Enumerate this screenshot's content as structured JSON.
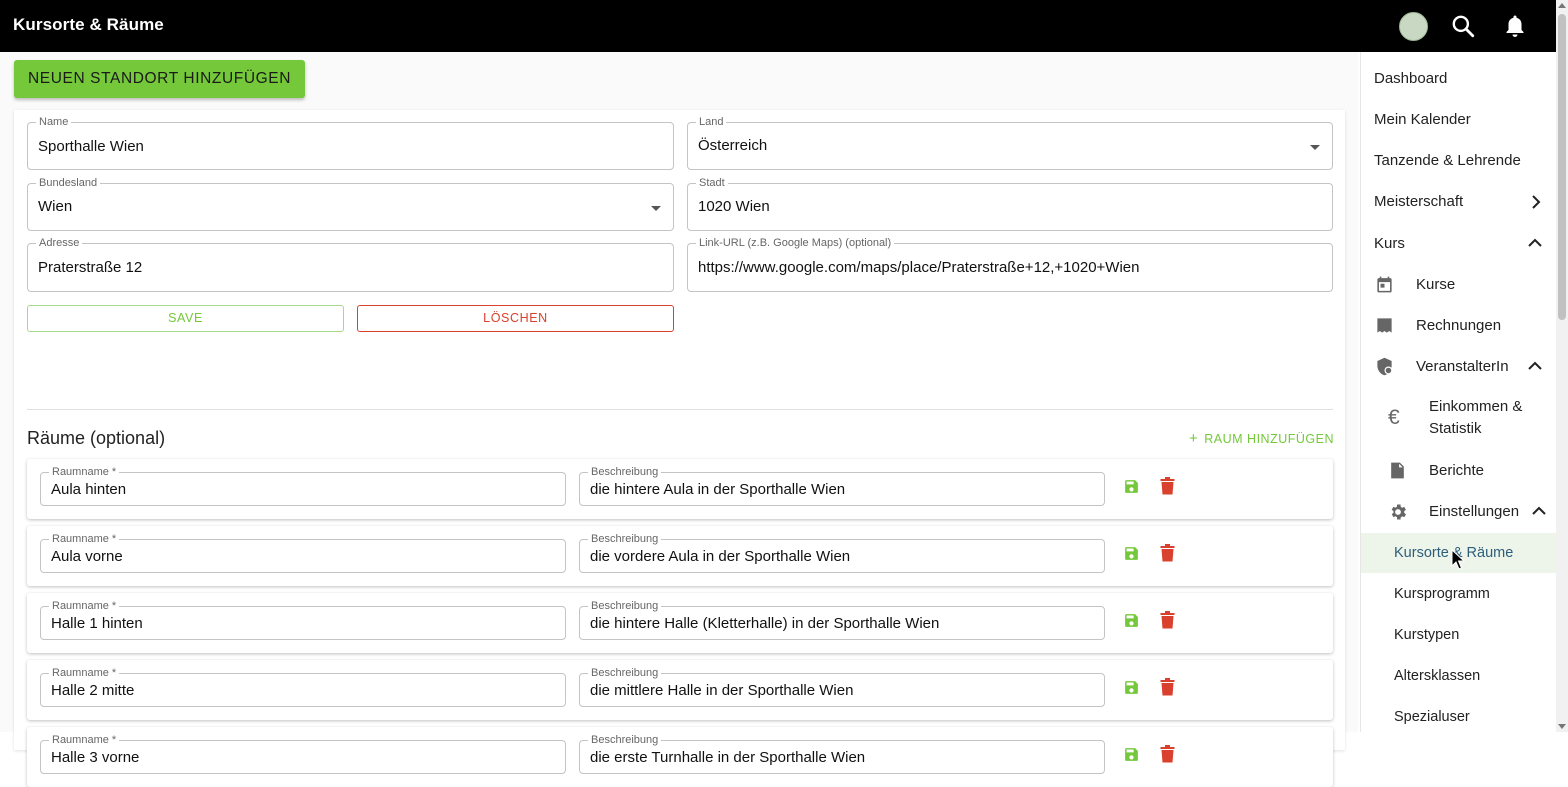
{
  "app": {
    "title": "Kursorte & Räume"
  },
  "header": {
    "avatar": "user-avatar",
    "search_icon": "search-icon",
    "bell_icon": "bell-icon"
  },
  "toolbar": {
    "add_location_label": "NEUEN STANDORT HINZUFÜGEN"
  },
  "location_form": {
    "name": {
      "label": "Name",
      "value": "Sporthalle Wien"
    },
    "country": {
      "label": "Land",
      "value": "Österreich"
    },
    "state": {
      "label": "Bundesland",
      "value": "Wien"
    },
    "city": {
      "label": "Stadt",
      "value": "1020 Wien"
    },
    "address": {
      "label": "Adresse",
      "value": "Praterstraße 12"
    },
    "link": {
      "label": "Link-URL (z.B. Google Maps) (optional)",
      "value": "https://www.google.com/maps/place/Praterstraße+12,+1020+Wien"
    },
    "save_label": "SAVE",
    "delete_label": "LÖSCHEN"
  },
  "rooms": {
    "title": "Räume (optional)",
    "add_label": "RAUM HINZUFÜGEN",
    "name_label": "Raumname *",
    "desc_label": "Beschreibung",
    "items": [
      {
        "name": "Aula hinten",
        "desc": "die hintere Aula in der Sporthalle Wien"
      },
      {
        "name": "Aula vorne",
        "desc": "die vordere Aula in der Sporthalle Wien"
      },
      {
        "name": "Halle 1 hinten",
        "desc": "die hintere Halle (Kletterhalle) in der Sporthalle Wien"
      },
      {
        "name": "Halle 2 mitte",
        "desc": "die mittlere Halle in der Sporthalle Wien"
      },
      {
        "name": "Halle 3 vorne",
        "desc": "die erste Turnhalle in der Sporthalle Wien"
      }
    ]
  },
  "sidebar": {
    "items": [
      {
        "label": "Dashboard"
      },
      {
        "label": "Mein Kalender"
      },
      {
        "label": "Tanzende & Lehrende"
      },
      {
        "label": "Meisterschaft",
        "chevron": "chevron-right-icon"
      },
      {
        "label": "Kurs",
        "chevron": "chevron-up-icon"
      },
      {
        "label": "Kurse",
        "icon": "calendar-icon"
      },
      {
        "label": "Rechnungen",
        "icon": "receipt-icon"
      },
      {
        "label": "VeranstalterIn",
        "icon": "shield-icon",
        "chevron": "chevron-up-icon"
      },
      {
        "label": "Einkommen &",
        "label2": "Statistik",
        "icon": "euro-icon"
      },
      {
        "label": "Berichte",
        "icon": "report-icon"
      },
      {
        "label": "Einstellungen",
        "icon": "gear-icon",
        "chevron": "chevron-up-icon"
      },
      {
        "label": "Kursorte & Räume",
        "active": true
      },
      {
        "label": "Kursprogramm"
      },
      {
        "label": "Kurstypen"
      },
      {
        "label": "Altersklassen"
      },
      {
        "label": "Spezialuser"
      }
    ]
  },
  "colors": {
    "accent_green": "#74c83a",
    "danger_red": "#d9412e",
    "topbar": "#000000",
    "active_bg": "#edf5ea",
    "active_text": "#2e5d7a"
  }
}
